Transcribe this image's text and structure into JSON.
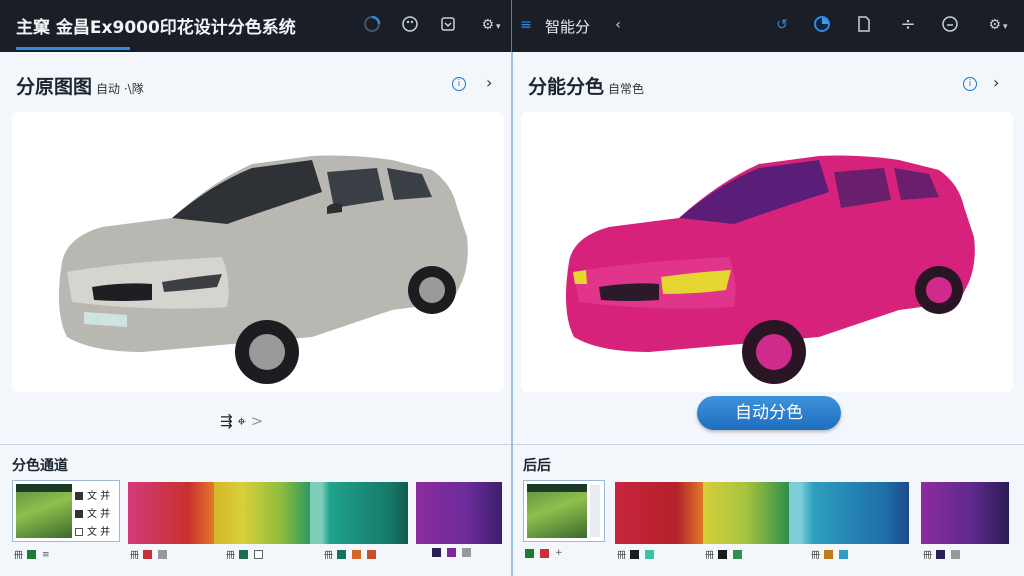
{
  "app": {
    "title": "主窠 金昌Ex9000印花设计分色系统",
    "right_title": "智能分",
    "colors": {
      "accent": "#2c8be0",
      "topbar": "#1a1f27",
      "button": "#2a80d0",
      "panel_bg": "#f3f7fb"
    }
  },
  "topbar": {
    "icons_left": [
      "progress-ring-icon",
      "palette-icon",
      "import-icon",
      "settings-gear-icon"
    ],
    "icons_right": [
      "menu-lines-icon",
      "back-chevron-icon",
      "refresh-icon",
      "circle-progress-icon",
      "document-icon",
      "divide-icon",
      "emoji-icon",
      "settings-gear-icon"
    ]
  },
  "left_panel": {
    "title": "分原图图",
    "subtitle": "自动 ·\\隊",
    "tools_text": "⇶ ⌖",
    "tools_chevron": ">",
    "channel_title": "分色通道",
    "thumb_rows": [
      "文 并",
      "文 并",
      "文 并"
    ],
    "swatch_labels": [
      "冊",
      "冊",
      "冊",
      "冊"
    ]
  },
  "right_panel": {
    "title": "分能分色",
    "subtitle": "自常色",
    "auto_button": "自动分色",
    "result_title": "后后",
    "swatch_labels": [
      "冊",
      "冊",
      "冊",
      "冊"
    ]
  }
}
